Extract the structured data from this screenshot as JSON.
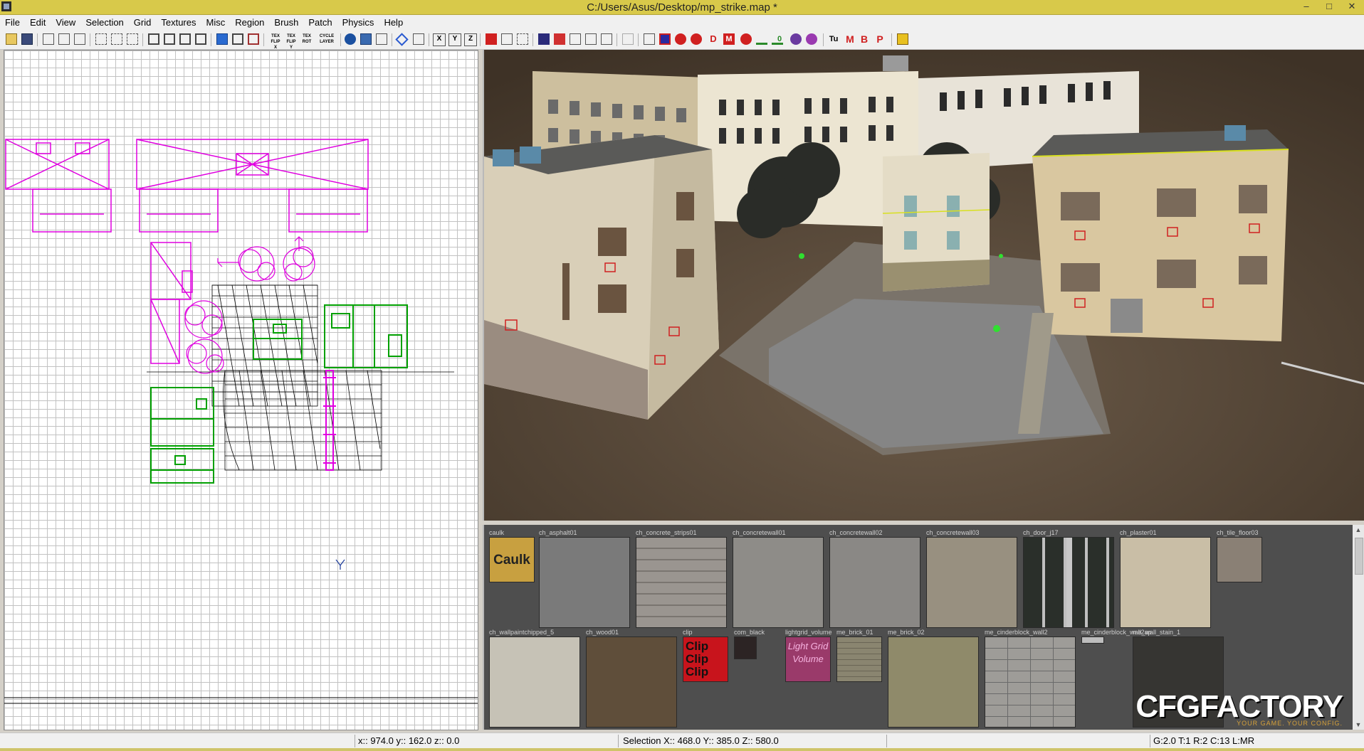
{
  "window": {
    "title": "C:/Users/Asus/Desktop/mp_strike.map *",
    "minimize": "–",
    "maximize": "□",
    "close": "✕"
  },
  "menu": [
    "File",
    "Edit",
    "View",
    "Selection",
    "Grid",
    "Textures",
    "Misc",
    "Region",
    "Brush",
    "Patch",
    "Physics",
    "Help"
  ],
  "toolbar": {
    "text_buttons": [
      "TEX FLIP X",
      "TEX FLIP Y",
      "TEX ROT",
      "CYCLE LAYER",
      "X",
      "Y",
      "Z",
      "D",
      "M",
      "0",
      "Tu",
      "M",
      "B",
      "P"
    ]
  },
  "colors": {
    "titlebar": "#d8c94a",
    "brush_selected": "#e000e0",
    "brush_green": "#00a000",
    "caulk": "#c8a040"
  },
  "texture_browser": {
    "textures": [
      {
        "name": "caulk",
        "swatch_text": "Caulk",
        "kind": "caulk"
      },
      {
        "name": "ch_asphalt01",
        "kind": "asphalt"
      },
      {
        "name": "ch_concrete_strips01",
        "kind": "strips"
      },
      {
        "name": "ch_concretewall01",
        "kind": "concrete1"
      },
      {
        "name": "ch_concretewall02",
        "kind": "concrete2"
      },
      {
        "name": "ch_concretewall03",
        "kind": "concrete3"
      },
      {
        "name": "ch_door_j17",
        "kind": "door"
      },
      {
        "name": "ch_plaster01",
        "kind": "plaster"
      },
      {
        "name": "ch_tile_floor03",
        "kind": "tile"
      },
      {
        "name": "ch_wallpaintchipped_5",
        "kind": "chipped"
      },
      {
        "name": "ch_wood01",
        "kind": "wood"
      },
      {
        "name": "clip",
        "swatch_text": "Clip Clip Clip",
        "kind": "clip"
      },
      {
        "name": "com_black",
        "kind": "black"
      },
      {
        "name": "lightgrid_volume",
        "swatch_text": "Light Grid Volume",
        "kind": "lightgrid"
      },
      {
        "name": "me_brick_01",
        "kind": "brick1"
      },
      {
        "name": "me_brick_02",
        "kind": "brick2"
      },
      {
        "name": "me_cinderblock_wall2",
        "kind": "cinder"
      },
      {
        "name": "me_cinderblock_wall2ap",
        "kind": "cinderap"
      },
      {
        "name": "me_wall_stain_1",
        "kind": "stain"
      }
    ]
  },
  "watermark": {
    "brand": "CFGFACTORY",
    "tagline": "YOUR GAME. YOUR CONFIG."
  },
  "status": {
    "cursor": "x:: 974.0  y:: 162.0  z:: 0.0",
    "selection": "Selection X:: 468.0  Y:: 385.0  Z:: 580.0",
    "grid": "G:2.0 T:1 R:2 C:13 L:MR"
  }
}
